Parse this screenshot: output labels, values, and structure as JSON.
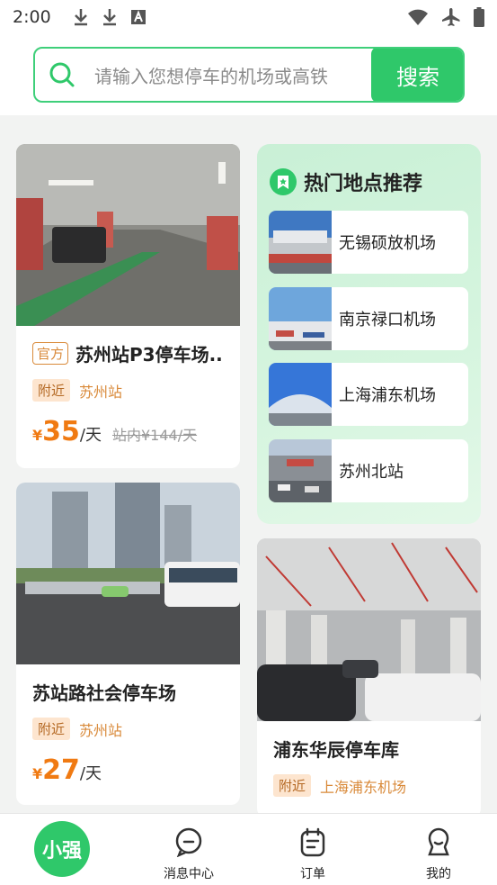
{
  "status_bar": {
    "time": "2:00"
  },
  "search": {
    "placeholder": "请输入您想停车的机场或高铁",
    "button": "搜索"
  },
  "lots": [
    {
      "official_tag": "官方",
      "title": "苏州站P3停车场...",
      "near_tag": "附近",
      "place": "苏州站",
      "yen": "¥",
      "price": "35",
      "unit": "/天",
      "old_price": "站内¥144/天"
    },
    {
      "title": "苏站路社会停车场",
      "near_tag": "附近",
      "place": "苏州站",
      "yen": "¥",
      "price": "27",
      "unit": "/天"
    },
    {
      "title": "浦东华辰停车库",
      "near_tag": "附近",
      "place": "上海浦东机场"
    }
  ],
  "hot": {
    "title": "热门地点推荐",
    "items": [
      {
        "label": "无锡硕放机场"
      },
      {
        "label": "南京禄口机场"
      },
      {
        "label": "上海浦东机场"
      },
      {
        "label": "苏州北站"
      }
    ]
  },
  "tabbar": {
    "home": "小强",
    "messages": "消息中心",
    "orders": "订单",
    "mine": "我的"
  },
  "colors": {
    "accent": "#2fc86a",
    "price": "#f07a12",
    "tag_bg": "#fde5cf"
  }
}
